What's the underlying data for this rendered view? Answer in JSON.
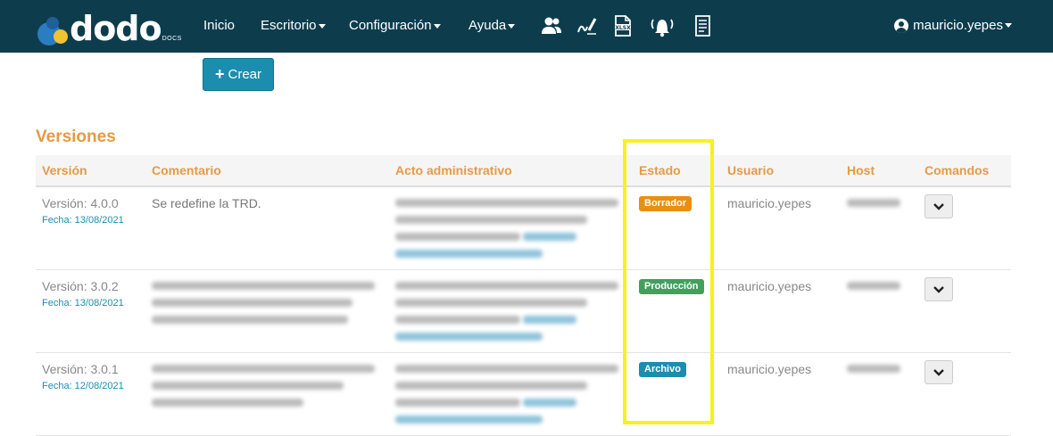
{
  "app": {
    "logo_text": "dodo",
    "logo_sub": "DOCS",
    "logo_reg": "®"
  },
  "nav": {
    "inicio": "Inicio",
    "escritorio": "Escritorio",
    "configuracion": "Configuración",
    "ayuda": "Ayuda",
    "icons": [
      "users-icon",
      "signature-icon",
      "xlsx-file-icon",
      "bell-icon",
      "document-list-icon"
    ],
    "user": "mauricio.yepes"
  },
  "actions": {
    "create_label": "Crear"
  },
  "section_title": "Versiones",
  "table": {
    "headers": {
      "version": "Versión",
      "comentario": "Comentario",
      "acto": "Acto administrativo",
      "estado": "Estado",
      "usuario": "Usuario",
      "host": "Host",
      "comandos": "Comandos"
    },
    "rows": [
      {
        "version": "Versión: 4.0.0",
        "fecha": "Fecha: 13/08/2021",
        "comentario": "Se redefine la TRD.",
        "estado": "Borrador",
        "usuario": "mauricio.yepes"
      },
      {
        "version": "Versión: 3.0.2",
        "fecha": "Fecha: 13/08/2021",
        "comentario": "",
        "estado": "Producción",
        "usuario": "mauricio.yepes"
      },
      {
        "version": "Versión: 3.0.1",
        "fecha": "Fecha: 12/08/2021",
        "comentario": "",
        "estado": "Archivo",
        "usuario": "mauricio.yepes"
      }
    ]
  },
  "colors": {
    "navbar": "#0d3d4d",
    "accent_orange": "#e59a45",
    "primary": "#1b8eb0",
    "borrador": "#e8900f",
    "produccion": "#3fa15b",
    "archivo": "#1b8eb0",
    "highlight": "#f7f21b"
  }
}
